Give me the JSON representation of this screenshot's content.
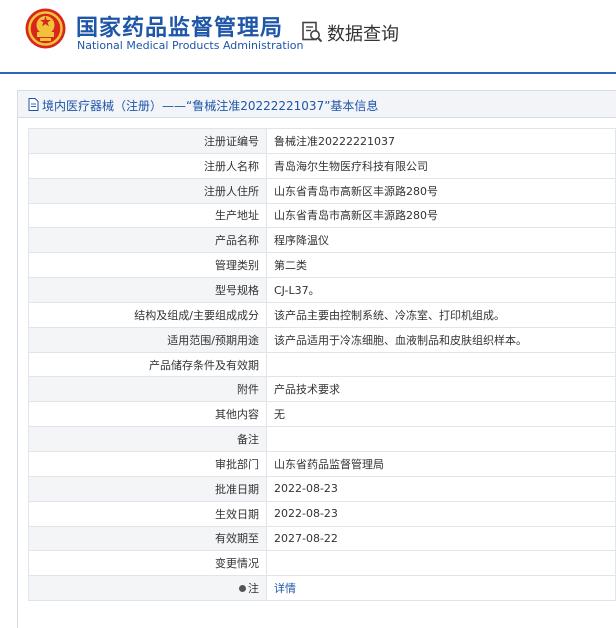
{
  "header": {
    "org_name_cn": "国家药品监督管理局",
    "org_name_en": "National Medical Products Administration",
    "search_title": "数据查询",
    "emblem_icon": "national-emblem-icon",
    "search_icon": "data-query-icon",
    "brand_color": "#1e56a8"
  },
  "breadcrumb": {
    "icon": "document-icon",
    "text": "境内医疗器械（注册）——“鲁械注准20222221037”基本信息"
  },
  "rows": [
    {
      "label": "注册证编号",
      "value": "鲁械注准20222221037"
    },
    {
      "label": "注册人名称",
      "value": "青岛海尔生物医疗科技有限公司"
    },
    {
      "label": "注册人住所",
      "value": "山东省青岛市高新区丰源路280号"
    },
    {
      "label": "生产地址",
      "value": "山东省青岛市高新区丰源路280号"
    },
    {
      "label": "产品名称",
      "value": "程序降温仪"
    },
    {
      "label": "管理类别",
      "value": "第二类"
    },
    {
      "label": "型号规格",
      "value": "CJ-L37。"
    },
    {
      "label": "结构及组成/主要组成成分",
      "value": "该产品主要由控制系统、冷冻室、打印机组成。"
    },
    {
      "label": "适用范围/预期用途",
      "value": "该产品适用于冷冻细胞、血液制品和皮肤组织样本。"
    },
    {
      "label": "产品储存条件及有效期",
      "value": ""
    },
    {
      "label": "附件",
      "value": "产品技术要求"
    },
    {
      "label": "其他内容",
      "value": "无"
    },
    {
      "label": "备注",
      "value": ""
    },
    {
      "label": "审批部门",
      "value": "山东省药品监督管理局"
    },
    {
      "label": "批准日期",
      "value": "2022-08-23"
    },
    {
      "label": "生效日期",
      "value": "2022-08-23"
    },
    {
      "label": "有效期至",
      "value": "2027-08-22"
    },
    {
      "label": "变更情况",
      "value": ""
    }
  ],
  "note_row": {
    "label": "注",
    "link_text": "详情",
    "icon": "bullet-icon"
  }
}
